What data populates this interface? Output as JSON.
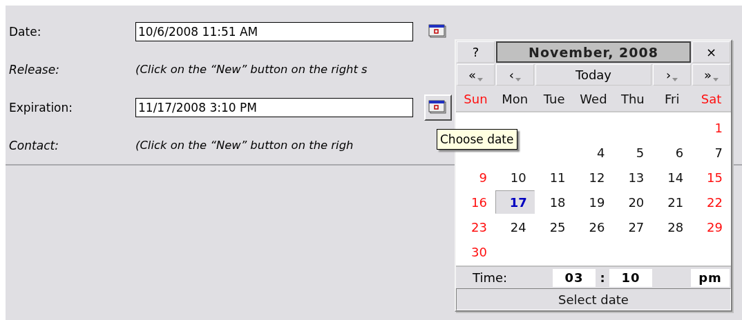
{
  "form": {
    "fields": [
      {
        "kind": "date",
        "label": "Date:",
        "value": "10/6/2008 11:51 AM",
        "button_hover": false
      },
      {
        "kind": "note",
        "label": "Release:",
        "text": "(Click on the “New” button on the right s"
      },
      {
        "kind": "date",
        "label": "Expiration:",
        "value": "11/17/2008 3:10 PM",
        "button_hover": true
      },
      {
        "kind": "note",
        "label": "Contact:",
        "text": "(Click on the “New” button on the righ"
      }
    ]
  },
  "tooltip": {
    "text": "Choose date"
  },
  "calendar": {
    "help": "?",
    "title": "November, 2008",
    "close": "×",
    "nav": [
      {
        "kind": "arrow",
        "label": "«"
      },
      {
        "kind": "arrow",
        "label": "‹"
      },
      {
        "kind": "today",
        "label": "Today"
      },
      {
        "kind": "arrow",
        "label": "›"
      },
      {
        "kind": "arrow",
        "label": "»"
      }
    ],
    "weekdays": [
      {
        "label": "Sun",
        "weekend": true
      },
      {
        "label": "Mon",
        "weekend": false
      },
      {
        "label": "Tue",
        "weekend": false
      },
      {
        "label": "Wed",
        "weekend": false
      },
      {
        "label": "Thu",
        "weekend": false
      },
      {
        "label": "Fri",
        "weekend": false
      },
      {
        "label": "Sat",
        "weekend": true
      }
    ],
    "weeks": [
      [
        {
          "kind": "blank"
        },
        {
          "kind": "blank"
        },
        {
          "kind": "blank"
        },
        {
          "kind": "blank"
        },
        {
          "kind": "blank"
        },
        {
          "kind": "blank"
        },
        {
          "kind": "day",
          "day": "1",
          "weekend": true,
          "selected": false
        }
      ],
      [
        {
          "kind": "blank"
        },
        {
          "kind": "blank"
        },
        {
          "kind": "blank"
        },
        {
          "kind": "day",
          "day": "4",
          "weekend": false,
          "selected": false
        },
        {
          "kind": "day",
          "day": "5",
          "weekend": false,
          "selected": false
        },
        {
          "kind": "day",
          "day": "6",
          "weekend": false,
          "selected": false
        },
        {
          "kind": "day",
          "day": "7",
          "weekend": false,
          "selected": false
        }
      ],
      [
        {
          "kind": "day",
          "day": "9",
          "weekend": true,
          "selected": false
        },
        {
          "kind": "day",
          "day": "10",
          "weekend": false,
          "selected": false
        },
        {
          "kind": "day",
          "day": "11",
          "weekend": false,
          "selected": false
        },
        {
          "kind": "day",
          "day": "12",
          "weekend": false,
          "selected": false
        },
        {
          "kind": "day",
          "day": "13",
          "weekend": false,
          "selected": false
        },
        {
          "kind": "day",
          "day": "14",
          "weekend": false,
          "selected": false
        },
        {
          "kind": "day",
          "day": "15",
          "weekend": true,
          "selected": false
        }
      ],
      [
        {
          "kind": "day",
          "day": "16",
          "weekend": true,
          "selected": false
        },
        {
          "kind": "day",
          "day": "17",
          "weekend": false,
          "selected": true
        },
        {
          "kind": "day",
          "day": "18",
          "weekend": false,
          "selected": false
        },
        {
          "kind": "day",
          "day": "19",
          "weekend": false,
          "selected": false
        },
        {
          "kind": "day",
          "day": "20",
          "weekend": false,
          "selected": false
        },
        {
          "kind": "day",
          "day": "21",
          "weekend": false,
          "selected": false
        },
        {
          "kind": "day",
          "day": "22",
          "weekend": true,
          "selected": false
        }
      ],
      [
        {
          "kind": "day",
          "day": "23",
          "weekend": true,
          "selected": false
        },
        {
          "kind": "day",
          "day": "24",
          "weekend": false,
          "selected": false
        },
        {
          "kind": "day",
          "day": "25",
          "weekend": false,
          "selected": false
        },
        {
          "kind": "day",
          "day": "26",
          "weekend": false,
          "selected": false
        },
        {
          "kind": "day",
          "day": "27",
          "weekend": false,
          "selected": false
        },
        {
          "kind": "day",
          "day": "28",
          "weekend": false,
          "selected": false
        },
        {
          "kind": "day",
          "day": "29",
          "weekend": true,
          "selected": false
        }
      ],
      [
        {
          "kind": "day",
          "day": "30",
          "weekend": true,
          "selected": false
        },
        {
          "kind": "blank"
        },
        {
          "kind": "blank"
        },
        {
          "kind": "blank"
        },
        {
          "kind": "blank"
        },
        {
          "kind": "blank"
        },
        {
          "kind": "blank"
        }
      ]
    ],
    "time": {
      "label": "Time:",
      "hour": "03",
      "separator": ":",
      "minute": "10",
      "ampm": "pm"
    },
    "select": "Select date"
  }
}
